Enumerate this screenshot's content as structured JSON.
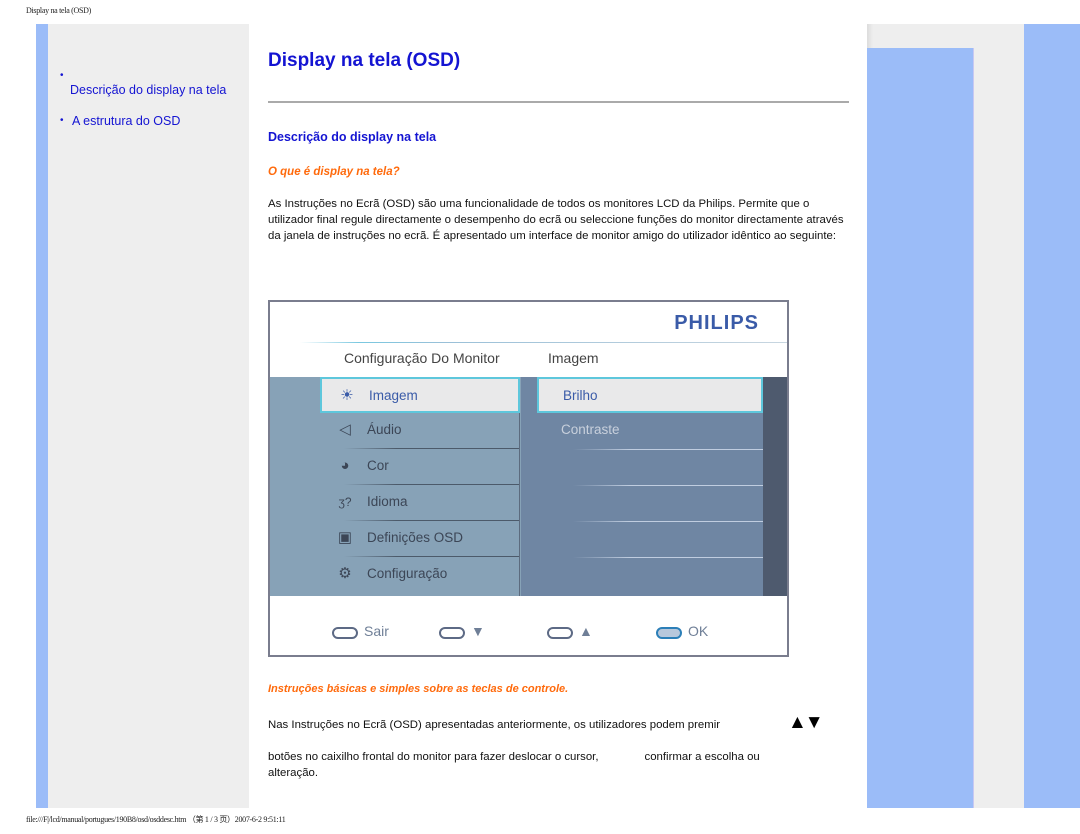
{
  "page_header": "Display na tela (OSD)",
  "page_footer": "file:///F|/lcd/manual/portugues/190B8/osd/osddesc.htm （第 1 / 3 页）2007-6-2 9:51:11",
  "sidebar": {
    "items": [
      {
        "label": "Descrição do display na tela"
      },
      {
        "label": "A estrutura do OSD"
      }
    ]
  },
  "main": {
    "title": "Display na tela (OSD)",
    "section_heading": "Descrição do display na tela",
    "question": "O que é display na tela?",
    "intro_paragraph": "As Instruções no Ecrã (OSD) são uma funcionalidade de todos os monitores LCD da Philips. Permite que o utilizador final regule directamente o desempenho do ecrã ou seleccione funções do monitor directamente através da janela de instruções no ecrã. É apresentado um interface de monitor amigo do utilizador idêntico ao seguinte:",
    "controls_heading": "Instruções básicas e simples sobre as teclas de controle.",
    "controls_line1": "Nas Instruções no Ecrã (OSD) apresentadas anteriormente, os utilizadores podem premir",
    "controls_arrows": "▲▼",
    "controls_line2a": "botões no caixilho frontal do monitor para fazer deslocar o cursor,",
    "controls_line2b": "confirmar a escolha ou",
    "controls_line3": "alteração."
  },
  "osd": {
    "brand": "PHILIPS",
    "breadcrumb_main": "Configuração Do Monitor",
    "breadcrumb_sub": "Imagem",
    "menu": [
      {
        "label": "Imagem",
        "icon": "sun-icon",
        "glyph": "☀",
        "selected": true
      },
      {
        "label": "Áudio",
        "icon": "speaker-icon",
        "glyph": "🕨",
        "selected": false
      },
      {
        "label": "Cor",
        "icon": "color-palette-icon",
        "glyph": "◕",
        "selected": false
      },
      {
        "label": "Idioma",
        "icon": "language-icon",
        "glyph": "ℑ",
        "selected": false
      },
      {
        "label": "Definições OSD",
        "icon": "osd-screen-icon",
        "glyph": "▣",
        "selected": false
      },
      {
        "label": "Configuração",
        "icon": "gear-icon",
        "glyph": "⚙",
        "selected": false
      }
    ],
    "submenu": [
      {
        "label": "Brilho",
        "selected": true
      },
      {
        "label": "Contraste",
        "selected": false
      }
    ],
    "buttons": [
      {
        "label": "Sair"
      },
      {
        "label": "▼"
      },
      {
        "label": "▲"
      },
      {
        "label": "OK"
      }
    ]
  }
}
